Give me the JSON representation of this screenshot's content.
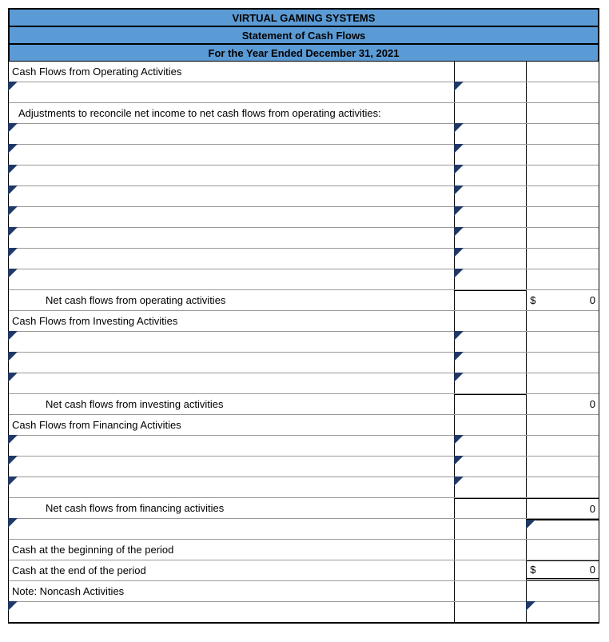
{
  "header": {
    "company": "VIRTUAL GAMING SYSTEMS",
    "title": "Statement of Cash Flows",
    "period": "For the Year Ended December 31, 2021"
  },
  "sections": {
    "operating_header": "Cash Flows from Operating Activities",
    "adjustments_note": "Adjustments to reconcile net income to net cash flows from operating activities:",
    "net_operating": "Net cash flows from operating activities",
    "investing_header": "Cash Flows from Investing Activities",
    "net_investing": "Net cash flows from investing activities",
    "financing_header": "Cash Flows from Financing Activities",
    "net_financing": "Net cash flows from financing activities",
    "cash_begin": "Cash at the beginning of the period",
    "cash_end": "Cash at the end of the period",
    "noncash_note": "Note: Noncash Activities"
  },
  "values": {
    "dollar": "$",
    "zero": "0",
    "net_operating_sym": "$",
    "net_operating_val": "0",
    "net_investing_val": "0",
    "net_financing_val": "0",
    "cash_end_sym": "$",
    "cash_end_val": "0"
  }
}
